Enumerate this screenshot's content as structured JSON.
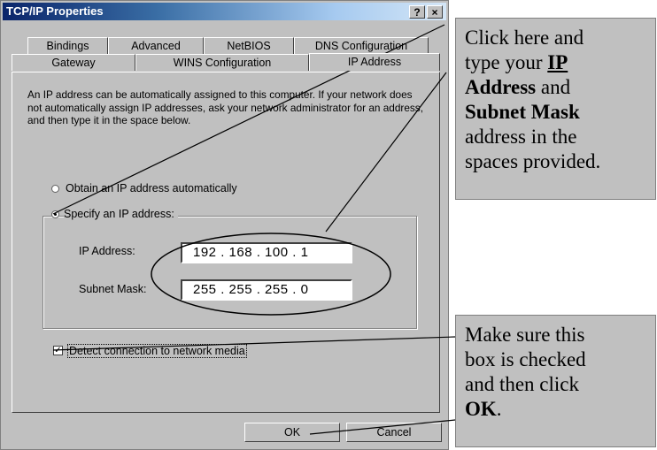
{
  "window": {
    "title": "TCP/IP Properties",
    "help_button": "?",
    "close_button": "×"
  },
  "tabs": {
    "row1": [
      "Bindings",
      "Advanced",
      "NetBIOS",
      "DNS Configuration"
    ],
    "row2": [
      "Gateway",
      "WINS Configuration",
      "IP Address"
    ]
  },
  "description": "An IP address can be automatically assigned to this computer. If your network does not automatically assign IP addresses, ask your network administrator for an address, and then type it in the space below.",
  "options": {
    "obtain_auto": "Obtain an IP address automatically",
    "specify": "Specify an IP address:"
  },
  "fields": {
    "ip_label": "IP Address:",
    "ip_value": "192 . 168 . 100 .  1",
    "subnet_label": "Subnet Mask:",
    "subnet_value": "255 . 255 . 255 .  0"
  },
  "checkbox": {
    "label": "Detect connection to network media",
    "checked": true
  },
  "buttons": {
    "ok": "OK",
    "cancel": "Cancel"
  },
  "callouts": {
    "top": {
      "line1": "Click here and",
      "line2_pre": "type your ",
      "line2_bold": "IP",
      "line3_bold": "Address",
      "line3_post": " and",
      "line4_bold": "Subnet Mask",
      "line5": "address in the",
      "line6": "spaces provided."
    },
    "bottom": {
      "line1": "Make sure this",
      "line2": "box is checked",
      "line3": "and then click",
      "line4_bold": "OK",
      "line4_post": "."
    }
  }
}
